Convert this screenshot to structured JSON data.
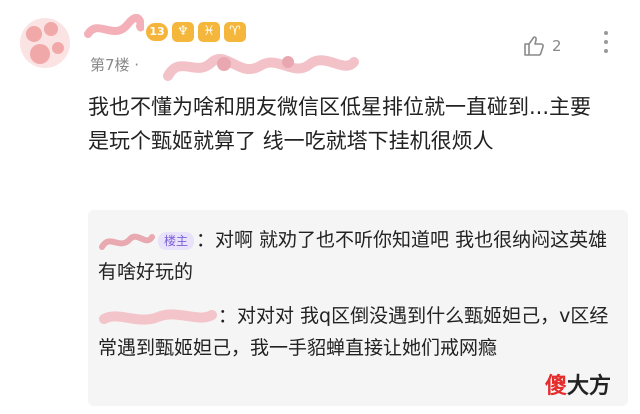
{
  "comment": {
    "level": "13",
    "zodiac_badges": [
      "♆",
      "♓",
      "♈"
    ],
    "floor": "第7楼 ·",
    "likes": "2",
    "text": "我也不懂为啥和朋友微信区低星排位就一直碰到...主要是玩个甄姬就算了 线一吃就塔下挂机很烦人"
  },
  "replies": [
    {
      "badge": "楼主",
      "text": "：对啊 就劝了也不听你知道吧 我也很纳闷这英雄有啥好玩的"
    },
    {
      "text": "：对对对 我q区倒没遇到什么甄姬妲己，v区经常遇到甄姬妲己，我一手貂蝉直接让她们戒网瘾"
    }
  ],
  "watermark": {
    "part1": "傻",
    "part2": "大方"
  },
  "colors": {
    "badge_orange": "#f4b63b",
    "op_badge_bg": "#e9e2fb",
    "op_badge_text": "#7b5fd6",
    "watermark_red": "#e62b2b"
  }
}
